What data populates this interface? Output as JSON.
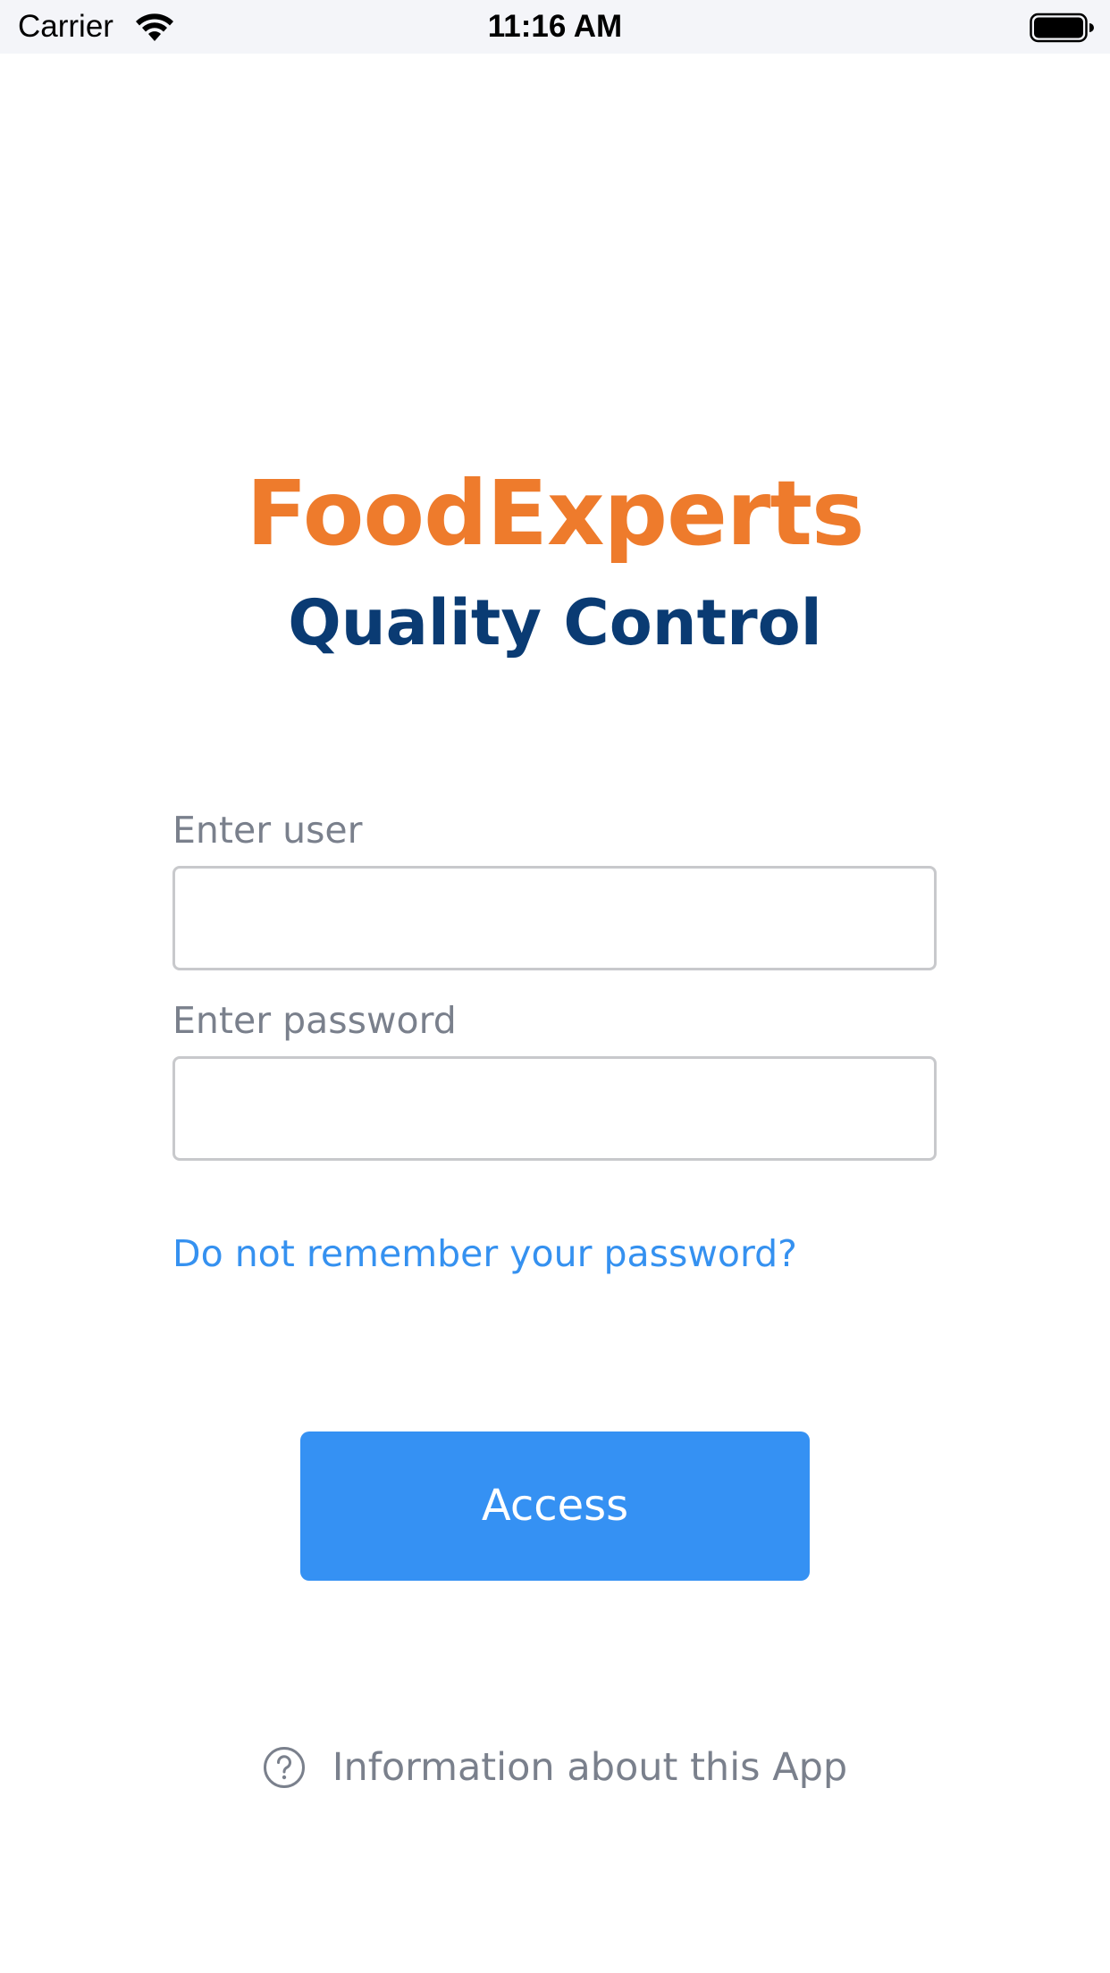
{
  "status_bar": {
    "carrier": "Carrier",
    "time": "11:16 AM",
    "wifi_icon": "wifi-icon",
    "battery_icon": "battery-icon"
  },
  "brand": {
    "title": "FoodExperts",
    "subtitle": "Quality Control",
    "title_color": "#ee7b2c",
    "subtitle_color": "#0a3b73"
  },
  "form": {
    "user_label": "Enter user",
    "user_value": "",
    "password_label": "Enter password",
    "password_value": "",
    "forgot_link": "Do not remember your password?",
    "submit_label": "Access",
    "accent_color": "#3591f3"
  },
  "footer": {
    "info_icon": "question-circle-icon",
    "info_text": "Information about this App"
  }
}
